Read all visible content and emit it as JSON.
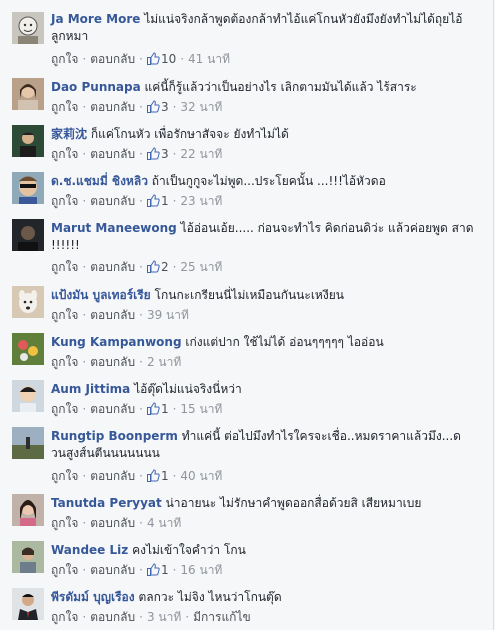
{
  "labels": {
    "like": "ถูกใจ",
    "reply": "ตอบกลับ",
    "sep": "·"
  },
  "colors": {
    "name": "#365899",
    "meta": "#90949c",
    "like_blue": "#4267b2"
  },
  "comments": [
    {
      "name": "Ja More More",
      "text": "ไม่แน่จริงกล้าพูดต้องกล้าทำไอ้แค่โกนหัวยังมึงยังทำไม่ได้ถุยไอ้ลูกหมา",
      "likes": "10",
      "time": "41 นาที",
      "avatar": "cartoon-face-avatar"
    },
    {
      "name": "Dao Punnapa",
      "text": "แค่นี้ก็รู้แล้วว่าเป็นอย่างไร เลิกตามมันได้แล้ว ไร้สาระ",
      "likes": "3",
      "time": "32 นาที",
      "avatar": "woman-avatar"
    },
    {
      "name": "家莉沈",
      "text": "ก็แค่โกนหัว เพื่อรักษาสัจจะ ยังทำไม่ได้",
      "likes": "3",
      "time": "22 นาที",
      "avatar": "man-avatar"
    },
    {
      "name": "ด.ช.แชมมี่ ชิงหลิว",
      "text": "ถ้าเป็นกูกูจะไม่พูด...ประโยคนั้น ...!!!ไอ้หัวดอ",
      "likes": "1",
      "time": "23 นาที",
      "avatar": "sunglasses-avatar"
    },
    {
      "name": "Marut Maneewong",
      "text": "ไอ้อ่อนเอ้ย..... ก่อนจะทำไร คิดก่อนดิว่ะ แล้วค่อยพูด สาด !!!!!!",
      "likes": "2",
      "time": "25 นาที",
      "avatar": "dark-avatar"
    },
    {
      "name": "แป้งมัน บูลเทอร์เรีย",
      "text": "โกนกะเกรียนนี่ไม่เหมือนกันนะเหงียน",
      "likes": "",
      "time": "39 นาที",
      "avatar": "dog-avatar"
    },
    {
      "name": "Kung Kampanwong",
      "text": "เก่งแต่ปาก ใช้ไม่ได้ อ่อนๆๆๆๆๆ ไออ่อน",
      "likes": "",
      "time": "2 นาที",
      "avatar": "flower-avatar"
    },
    {
      "name": "Aum Jittima",
      "text": "ไอ้ตุ๊ดไม่แน่จริงนี่หว่า",
      "likes": "1",
      "time": "15 นาที",
      "avatar": "child-avatar"
    },
    {
      "name": "Rungtip Boonperm",
      "text": "ทำแค่นี้ ต่อไปมึงทำไรใครจะเชื่อ..หมดราคาแล้วมึง...ดวนสูงส์นตีนนนนนนน",
      "likes": "1",
      "time": "40 นาที",
      "avatar": "landscape-avatar"
    },
    {
      "name": "Tanutda Peryyat",
      "text": "น่าอายนะ ไม่รักษาคำพูดออกสื่อด้วยสิ เสียหมาเบย",
      "likes": "",
      "time": "4 นาที",
      "avatar": "girl-avatar"
    },
    {
      "name": "Wandee Liz",
      "text": "คงไม่เข้าใจคำว่า โกน",
      "likes": "1",
      "time": "16 นาที",
      "avatar": "person-avatar"
    },
    {
      "name": "พีรดัมม์ บุญเรือง",
      "text": "ตลกวะ ไม่จิง ไหนว่าโกนตุ๊ด",
      "likes": "",
      "time": "3 นาที",
      "extra": "มีการแก้ไข",
      "avatar": "suit-avatar"
    }
  ]
}
